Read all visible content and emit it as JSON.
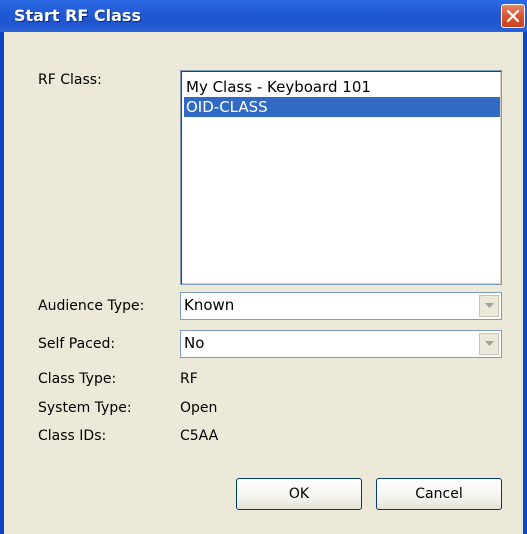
{
  "dialog": {
    "title": "Start RF Class"
  },
  "form": {
    "rf_class_label": "RF Class:",
    "rf_class_items": [
      "My Class - Keyboard 101",
      "OID-CLASS"
    ],
    "rf_class_selected_index": 1,
    "audience_type_label": "Audience Type:",
    "audience_type_value": "Known",
    "self_paced_label": "Self Paced:",
    "self_paced_value": "No",
    "class_type_label": "Class Type:",
    "class_type_value": "RF",
    "system_type_label": "System Type:",
    "system_type_value": "Open",
    "class_ids_label": "Class IDs:",
    "class_ids_value": "C5AA"
  },
  "buttons": {
    "ok_label": "OK",
    "cancel_label": "Cancel"
  },
  "icons": {
    "close": "close-icon",
    "dropdown": "chevron-down-icon"
  },
  "colors": {
    "titlebar": "#2158d4",
    "selection": "#316ac5",
    "dialog_bg": "#ece9d8",
    "close_button": "#d8552f"
  }
}
